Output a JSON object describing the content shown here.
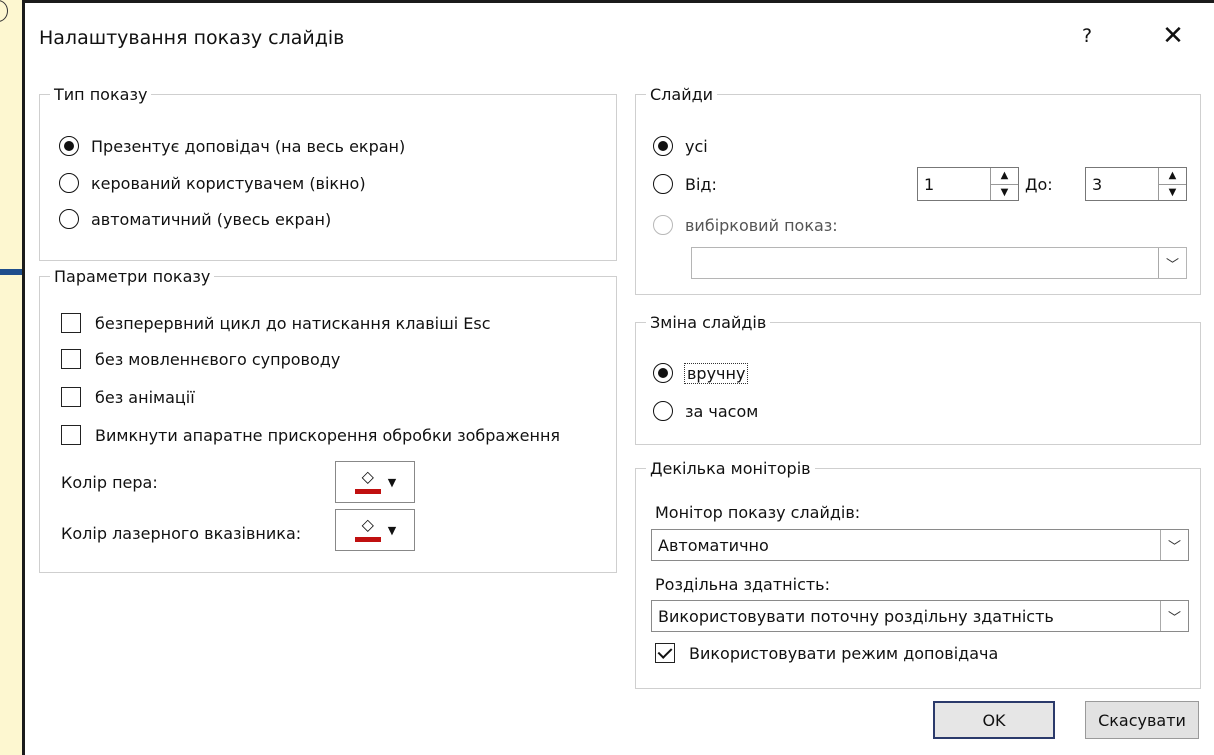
{
  "dialog": {
    "title": "Налаштування показу слайдів",
    "help_glyph": "?",
    "close_glyph": "✕"
  },
  "show_type": {
    "legend": "Тип показу",
    "options": [
      {
        "label": "Презентує доповідач (на весь екран)",
        "checked": true
      },
      {
        "label": "керований користувачем (вікно)",
        "checked": false
      },
      {
        "label": "автоматичний (увесь екран)",
        "checked": false
      }
    ]
  },
  "show_options": {
    "legend": "Параметри показу",
    "checkboxes": [
      {
        "label": "безперервний цикл до натискання клавіші Esc",
        "checked": false
      },
      {
        "label": "без мовленнєвого супроводу",
        "checked": false
      },
      {
        "label": "без анімації",
        "checked": false
      },
      {
        "label": "Вимкнути апаратне прискорення обробки зображення",
        "checked": false
      }
    ],
    "pen_color_label": "Колір пера:",
    "laser_color_label": "Колір лазерного вказівника:",
    "pen_color": "#c01010",
    "laser_color": "#c01010"
  },
  "slides": {
    "legend": "Слайди",
    "all_label": "усі",
    "from_label": "Від:",
    "to_label": "До:",
    "from_value": "1",
    "to_value": "3",
    "custom_label": "вибірковий показ:",
    "custom_value": ""
  },
  "advance": {
    "legend": "Зміна слайдів",
    "manual_label": "вручну",
    "timings_label": "за часом"
  },
  "monitors": {
    "legend": "Декілька моніторів",
    "monitor_label": "Монітор показу слайдів:",
    "monitor_value": "Автоматично",
    "resolution_label": "Роздільна здатність:",
    "resolution_value": "Використовувати поточну роздільну здатність",
    "presenter_view_label": "Використовувати режим доповідача",
    "presenter_view_checked": true
  },
  "buttons": {
    "ok": "OK",
    "cancel": "Скасувати"
  },
  "colors": {
    "page_background": "#fbf6d2",
    "arrow": "#1f4e8c",
    "default_button_border": "#2b3a6b"
  }
}
